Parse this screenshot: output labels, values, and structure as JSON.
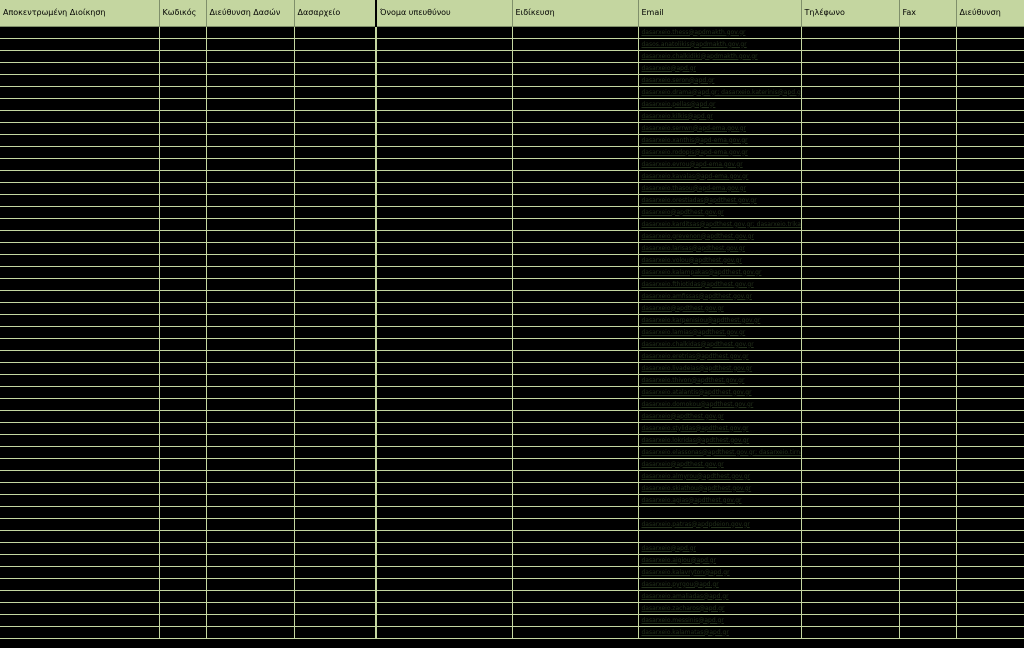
{
  "colors": {
    "header_bg": "#c4d6a0",
    "grid_line": "#c4d6a0",
    "cell_bg": "#000000"
  },
  "header": {
    "columns": [
      "Αποκεντρωμένη Διοίκηση",
      "Κωδικός",
      "Διεύθυνση Δασών",
      "Δασαρχείο",
      "Όνομα υπευθύνου",
      "Ειδίκευση",
      "Email",
      "Τηλέφωνο",
      "Fax",
      "Διεύθυνση"
    ]
  },
  "rows": [
    {
      "email": "dasarxeio.thess@apdmakth.gov.gr"
    },
    {
      "email": "dasos.anatolikis@apdmakth.gov.gr"
    },
    {
      "email": "dasarxeio.chalkidiki@apdmakth.gov.gr"
    },
    {
      "email": "dasarxeio@apd.gr"
    },
    {
      "email": "dasarxeio.seron@apd.gr"
    },
    {
      "email": "dasarxeio.drama@apd.gr; dasarxeio.katerinis@apd.gr"
    },
    {
      "email": "dasarxeio.pellas@apd.gr"
    },
    {
      "email": "dasarxeio.kilkis@apd.gr"
    },
    {
      "email": "dasarxeio.serrwn@apd-ema.gov.gr"
    },
    {
      "email": "dasarxeio.xanthis@apd-ema.gov.gr"
    },
    {
      "email": "dasarxeio.rodopis@apd-ema.gov.gr"
    },
    {
      "email": "dasarxeio.evrou@apd-ema.gov.gr"
    },
    {
      "email": "dasarxeio.kavalas@apd-ema.gov.gr"
    },
    {
      "email": "dasarxeio.thasou@apd-ema.gov.gr"
    },
    {
      "email": "dasarxeio.orestiadas@apdthest.gov.gr"
    },
    {
      "email": "dasarxeio@apdthest.gov.gr"
    },
    {
      "email": "dasarxeio.karditsas@apdthest.gov.gr; dasarxeio.trikalon@apdthest.gov.gr"
    },
    {
      "email": "dasarxeio.grevenon@apdthest.gov.gr"
    },
    {
      "email": "dasarxeio.larisas@apdthest.gov.gr"
    },
    {
      "email": "dasarxeio.volou@apdthest.gov.gr"
    },
    {
      "email": "dasarxeio.kalampakas@apdthest.gov.gr"
    },
    {
      "email": "dasarxeio.fthiotidas@apdthest.gov.gr"
    },
    {
      "email": "dasarxeio.amfissas@apdthest.gov.gr"
    },
    {
      "email": "dasarxeio@apdthest.gov.gr"
    },
    {
      "email": "dasarxeio.karpenisiou@apdthest.gov.gr"
    },
    {
      "email": "dasarxeio.lamias@apdthest.gov.gr"
    },
    {
      "email": "dasarxeio.chalkidas@apdthest.gov.gr"
    },
    {
      "email": "dasarxeio.eretrias@apdthest.gov.gr"
    },
    {
      "email": "dasarxeio.livadeias@apdthest.gov.gr"
    },
    {
      "email": "dasarxeio.thivon@apdthest.gov.gr"
    },
    {
      "email": "dasarxeio.atalantis@apdthest.gov.gr"
    },
    {
      "email": "dasarxeio.domokou@apdthest.gov.gr"
    },
    {
      "email": "dasarxeio@apdthest.gov.gr"
    },
    {
      "email": "dasarxeio.stylidas@apdthest.gov.gr"
    },
    {
      "email": "dasarxeio.lokridas@apdthest.gov.gr"
    },
    {
      "email": "dasarxeio.elassonas@apdthest.gov.gr; dasarxeio.tirnavou@apdthest.gov.gr"
    },
    {
      "email": "dasarxeio@apdthest.gov.gr"
    },
    {
      "email": "dasarxeio.almyrou@apdthest.gov.gr"
    },
    {
      "email": "dasarxeio.skiathou@apdthest.gov.gr"
    },
    {
      "email": "dasarxeio.agias@apdthest.gov.gr"
    },
    {
      "email": ""
    },
    {
      "email": "dasarxeio.patras@apdpdeion.gov.gr"
    },
    {
      "email": ""
    },
    {
      "email": "dasarxeio@apd.gr"
    },
    {
      "email": "dasarxeio.aigiou@apd.gr"
    },
    {
      "email": "dasarxeio.kalavryton@apd.gr"
    },
    {
      "email": "dasarxeio.pyrgou@apd.gr"
    },
    {
      "email": "dasarxeio.amaliadas@apd.gr"
    },
    {
      "email": "dasarxeio.zacharos@apd.gr"
    },
    {
      "email": "dasarxeio.messinis@apd.gr"
    },
    {
      "email": "dasarxeio.kalamatas@apd.gr"
    }
  ]
}
